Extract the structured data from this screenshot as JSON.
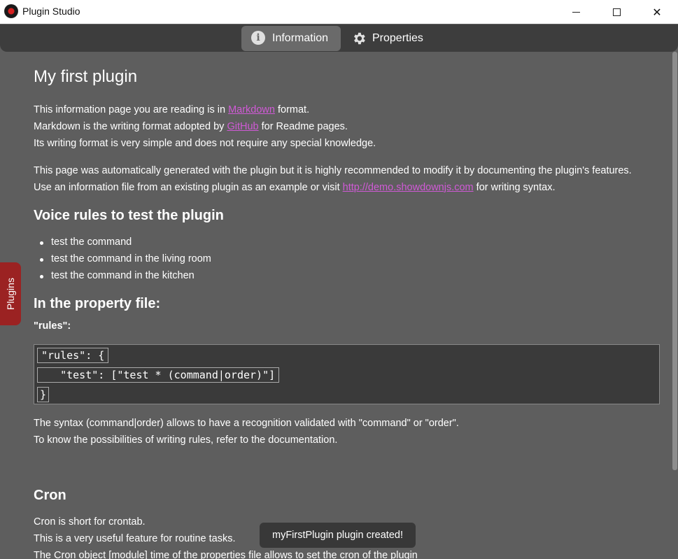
{
  "window": {
    "title": "Plugin Studio",
    "minimize_glyph": "",
    "close_glyph": "✕"
  },
  "tabs": [
    {
      "label": "Information",
      "icon": "info-icon",
      "active": true
    },
    {
      "label": "Properties",
      "icon": "gear-icon",
      "active": false
    }
  ],
  "content": {
    "title": "My first plugin",
    "intro": {
      "line1_pre": "This information page you are reading is in ",
      "line1_link": "Markdown",
      "line1_post": " format.",
      "line2_pre": "Markdown is the writing format adopted by ",
      "line2_link": "GitHub",
      "line2_post": " for Readme pages.",
      "line3": "Its writing format is very simple and does not require any special knowledge."
    },
    "para2": {
      "line1": "This page was automatically generated with the plugin but it is highly recommended to modify it by documenting the plugin's features.",
      "line2_pre": "Use an information file from an existing plugin as an example or visit ",
      "line2_link": "http://demo.showdownjs.com",
      "line2_post": " for writing syntax."
    },
    "voice_heading": "Voice rules to test the plugin",
    "voice_rules": [
      "test the command",
      "test the command in the living room",
      "test the command in the kitchen"
    ],
    "property_heading": "In the property file:",
    "rules_label": "\"rules\":",
    "code_lines": [
      "\"rules\": {",
      "   \"test\": [\"test * (command|order)\"]",
      "}"
    ],
    "syntax": {
      "line1": "The syntax (command|order) allows to have a recognition validated with \"command\" or \"order\".",
      "line2": "To know the possibilities of writing rules, refer to the documentation."
    },
    "cron_heading": "Cron",
    "cron": {
      "line1": "Cron is short for crontab.",
      "line2": "This is a very useful feature for routine tasks.",
      "line3": "The Cron object [module] time of the properties file allows to set the cron of the plugin"
    }
  },
  "side_tab": {
    "label": "Plugins"
  },
  "toast": {
    "message": "myFirstPlugin plugin created!"
  },
  "colors": {
    "background": "#5e5e5e",
    "tabbar": "#3d3d3d",
    "link": "#d05ad6",
    "side_tab": "#9b2222"
  }
}
